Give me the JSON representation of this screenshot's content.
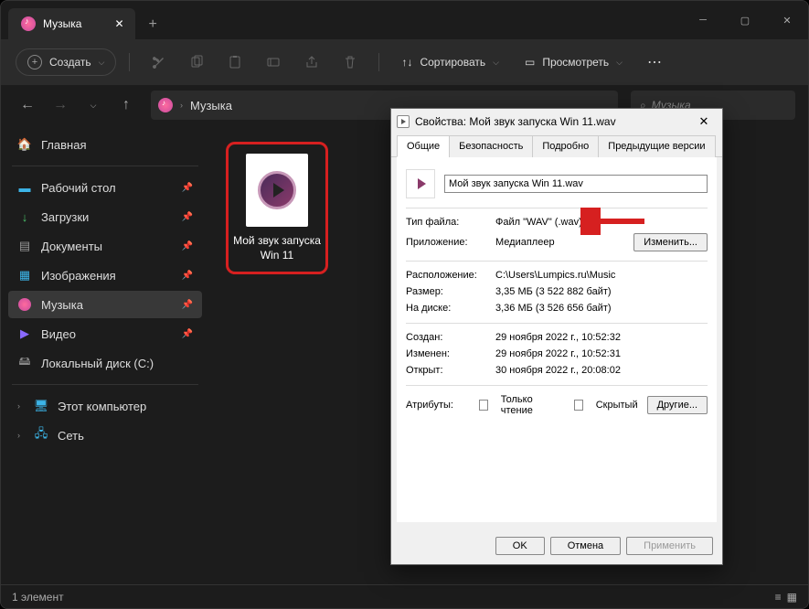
{
  "titlebar": {
    "tab_label": "Музыка"
  },
  "toolbar": {
    "create": "Создать",
    "sort": "Сортировать",
    "view": "Просмотреть"
  },
  "breadcrumb": {
    "folder": "Музыка"
  },
  "search": {
    "placeholder": "Музыка"
  },
  "sidebar": {
    "home": "Главная",
    "desktop": "Рабочий стол",
    "downloads": "Загрузки",
    "documents": "Документы",
    "pictures": "Изображения",
    "music": "Музыка",
    "videos": "Видео",
    "disk_c": "Локальный диск (C:)",
    "this_pc": "Этот компьютер",
    "network": "Сеть"
  },
  "file": {
    "name": "Мой звук запуска Win 11"
  },
  "status": {
    "count": "1 элемент"
  },
  "dialog": {
    "title": "Свойства: Мой звук запуска Win 11.wav",
    "tabs": {
      "general": "Общие",
      "security": "Безопасность",
      "details": "Подробно",
      "prev": "Предыдущие версии"
    },
    "filename": "Мой звук запуска Win 11.wav",
    "type_lbl": "Тип файла:",
    "type_val": "Файл \"WAV\" (.wav)",
    "app_lbl": "Приложение:",
    "app_val": "Медиаплеер",
    "change_btn": "Изменить...",
    "loc_lbl": "Расположение:",
    "loc_val": "C:\\Users\\Lumpics.ru\\Music",
    "size_lbl": "Размер:",
    "size_val": "3,35 МБ (3 522 882 байт)",
    "ondisk_lbl": "На диске:",
    "ondisk_val": "3,36 МБ (3 526 656 байт)",
    "created_lbl": "Создан:",
    "created_val": "29 ноября 2022 г., 10:52:32",
    "modified_lbl": "Изменен:",
    "modified_val": "29 ноября 2022 г., 10:52:31",
    "opened_lbl": "Открыт:",
    "opened_val": "30 ноября 2022 г., 20:08:02",
    "attr_lbl": "Атрибуты:",
    "readonly": "Только чтение",
    "hidden": "Скрытый",
    "other_btn": "Другие...",
    "ok": "OK",
    "cancel": "Отмена",
    "apply": "Применить"
  }
}
